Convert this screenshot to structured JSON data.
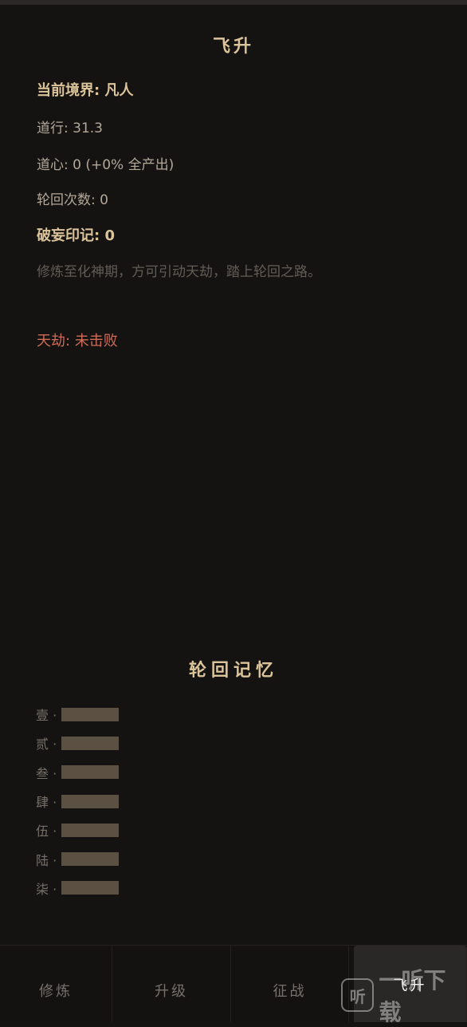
{
  "page": {
    "title": "飞升",
    "stats": {
      "realm": "当前境界: 凡人",
      "daoxing": "道行: 31.3",
      "daoxin": "道心: 0 (+0% 全产出)",
      "reincarnations": "轮回次数: 0",
      "pojin_mark": "破妄印记: 0",
      "hint": "修炼至化神期，方可引动天劫，踏上轮回之路。",
      "tribulation": "天劫: 未击败"
    }
  },
  "memory": {
    "title": "轮回记忆",
    "items": [
      {
        "label": "壹 ·"
      },
      {
        "label": "贰 ·"
      },
      {
        "label": "叁 ·"
      },
      {
        "label": "肆 ·"
      },
      {
        "label": "伍 ·"
      },
      {
        "label": "陆 ·"
      },
      {
        "label": "柒 ·"
      }
    ]
  },
  "tabs": [
    {
      "label": "修炼"
    },
    {
      "label": "升级"
    },
    {
      "label": "征战"
    },
    {
      "label": "飞升",
      "active": true
    }
  ],
  "watermark": {
    "icon": "听",
    "text": "一听下载"
  },
  "colors": {
    "background": "#151312",
    "accent_gold": "#dcc49a",
    "text": "#b3a89a",
    "danger": "#d06b57",
    "locked_bar": "#5b5042"
  }
}
